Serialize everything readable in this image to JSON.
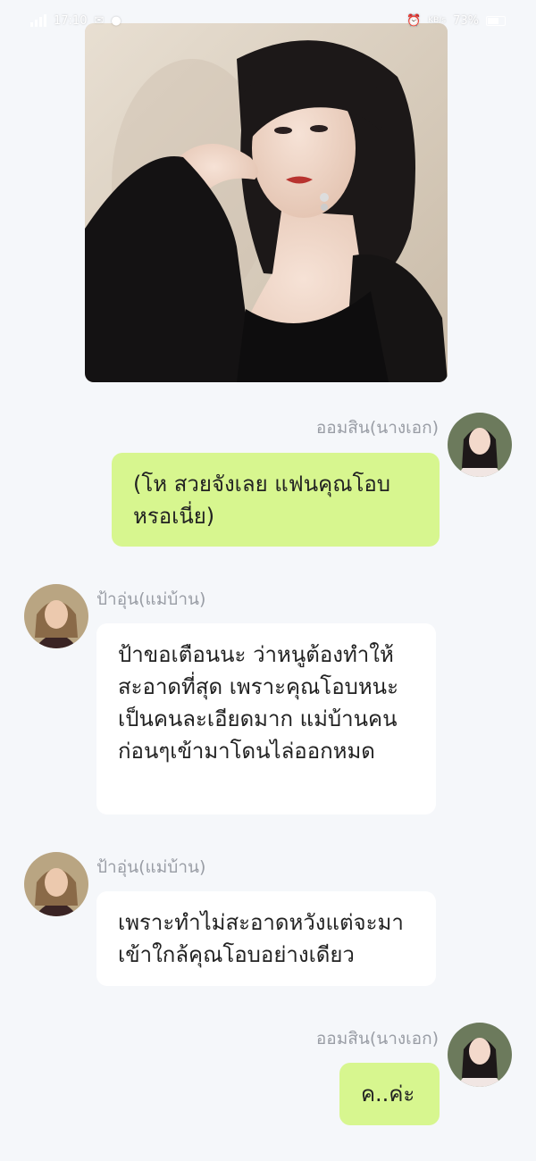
{
  "status_bar": {
    "time": "17:10",
    "net_speed": "KB/s",
    "battery": "73%"
  },
  "photo": {
    "description_icon": "portrait-photo"
  },
  "messages": [
    {
      "sender": "ออมสิน(นางเอก)",
      "side": "right",
      "text": "(โห สวยจังเลย แฟนคุณโอบหรอเนี่ย)"
    },
    {
      "sender": "ป้าอุ่น(แม่บ้าน)",
      "side": "left",
      "text": "ป้าขอเตือนนะ ว่าหนูต้องทำให้สะอาดที่สุด เพราะคุณโอบหนะเป็นคนละเอียดมาก แม่บ้านคนก่อนๆเข้ามาโดนไล่ออกหมด"
    },
    {
      "sender": "ป้าอุ่น(แม่บ้าน)",
      "side": "left",
      "text": "เพราะทำไม่สะอาดหวังแต่จะมาเข้าใกล้คุณโอบอย่างเดียว"
    },
    {
      "sender": "ออมสิน(นางเอก)",
      "side": "right",
      "text": "ค..ค่ะ"
    }
  ],
  "colors": {
    "my_bubble": "#d7f68f",
    "other_bubble": "#ffffff",
    "background": "#f5f7fa",
    "name_text": "#999da5"
  }
}
